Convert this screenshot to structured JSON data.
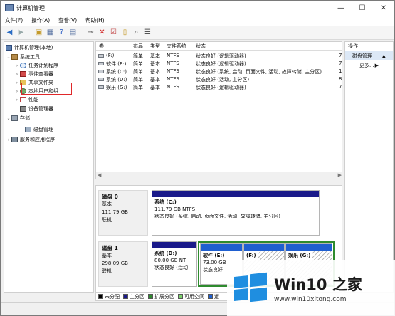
{
  "window": {
    "title": "计算机管理",
    "minimize": "—",
    "maximize": "☐",
    "close": "✕"
  },
  "menu": [
    "文件(F)",
    "操作(A)",
    "查看(V)",
    "帮助(H)"
  ],
  "toolbar": {
    "icons": [
      "back-icon",
      "forward-icon",
      "up-icon",
      "properties-icon",
      "help-icon",
      "view-icon",
      "connect-icon",
      "delete-icon",
      "check-icon",
      "open-icon",
      "search-icon",
      "list-icon"
    ]
  },
  "tree": {
    "root": "计算机管理(本地)",
    "system_tools": "系统工具",
    "task_scheduler": "任务计划程序",
    "event_viewer": "事件查看器",
    "shared_folders": "共享文件夹",
    "local_users": "本地用户和组",
    "performance": "性能",
    "device_manager": "设备管理器",
    "storage": "存储",
    "disk_management": "磁盘管理",
    "services": "服务和应用程序"
  },
  "volumes": {
    "headers": [
      "卷",
      "布局",
      "类型",
      "文件系统",
      "状态"
    ],
    "rows": [
      {
        "vol": "(F:)",
        "layout": "简单",
        "type": "基本",
        "fs": "NTFS",
        "status": "状态良好 (逻辑驱动器)",
        "cap": "7"
      },
      {
        "vol": "软件 (E:)",
        "layout": "简单",
        "type": "基本",
        "fs": "NTFS",
        "status": "状态良好 (逻辑驱动器)",
        "cap": "7"
      },
      {
        "vol": "系统 (C:)",
        "layout": "简单",
        "type": "基本",
        "fs": "NTFS",
        "status": "状态良好 (系统, 启动, 页面文件, 活动, 故障转储, 主分区)",
        "cap": "1"
      },
      {
        "vol": "系统 (D:)",
        "layout": "简单",
        "type": "基本",
        "fs": "NTFS",
        "status": "状态良好 (活动, 主分区)",
        "cap": "8"
      },
      {
        "vol": "娱乐 (G:)",
        "layout": "简单",
        "type": "基本",
        "fs": "NTFS",
        "status": "状态良好 (逻辑驱动器)",
        "cap": "7"
      }
    ],
    "scroll_left": "◀",
    "scroll_right": "▶"
  },
  "disks": [
    {
      "name": "磁盘 0",
      "type": "基本",
      "size": "111.79 GB",
      "state": "联机",
      "partitions": [
        {
          "name": "系统 (C:)",
          "line2": "111.79 GB NTFS",
          "line3": "状态良好 (系统, 启动, 页面文件, 活动, 故障转储, 主分区)"
        }
      ]
    },
    {
      "name": "磁盘 1",
      "type": "基本",
      "size": "298.09 GB",
      "state": "联机",
      "partitions": [
        {
          "name": "系统 (D:)",
          "line2": "80.00 GB NT",
          "line3": "状态良好 (活动"
        },
        {
          "name": "软件 (E:)",
          "line2": "73.00 GB",
          "line3": "状态良好"
        },
        {
          "name": "(F:)",
          "line2": "",
          "line3": ""
        },
        {
          "name": "娱乐 (G:)",
          "line2": "",
          "line3": ""
        }
      ]
    }
  ],
  "legend": [
    {
      "label": "未分配",
      "color": "#000000"
    },
    {
      "label": "主分区",
      "color": "#1a1a8a"
    },
    {
      "label": "扩展分区",
      "color": "#2e8b2e"
    },
    {
      "label": "可用空间",
      "color": "#7bd36b"
    },
    {
      "label": "逻",
      "color": "#1f5fd0"
    }
  ],
  "actions": {
    "header": "操作",
    "selected": "磁盘管理",
    "more": "更多..."
  },
  "watermark": {
    "title": "Win10 之家",
    "url": "www.win10xitong.com"
  }
}
